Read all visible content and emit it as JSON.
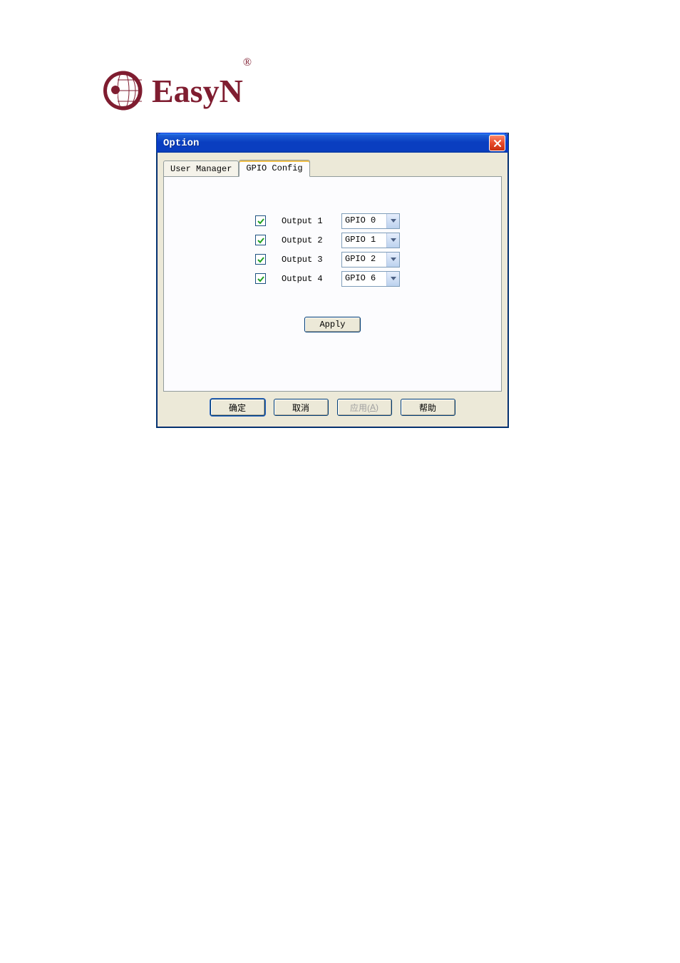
{
  "logo": {
    "text": "EasyN",
    "registered": "®"
  },
  "window": {
    "title": "Option",
    "tabs": {
      "user_manager": "User Manager",
      "gpio_config": "GPIO Config",
      "active": 1
    },
    "gpio": {
      "rows": [
        {
          "checked": true,
          "label": "Output 1",
          "value": "GPIO 0"
        },
        {
          "checked": true,
          "label": "Output 2",
          "value": "GPIO 1"
        },
        {
          "checked": true,
          "label": "Output 3",
          "value": "GPIO 2"
        },
        {
          "checked": true,
          "label": "Output 4",
          "value": "GPIO 6"
        }
      ],
      "apply_label": "Apply"
    },
    "buttons": {
      "ok": "确定",
      "cancel": "取消",
      "apply_prefix": "应用(",
      "apply_accel": "A",
      "apply_suffix": ")",
      "help": "帮助"
    }
  }
}
